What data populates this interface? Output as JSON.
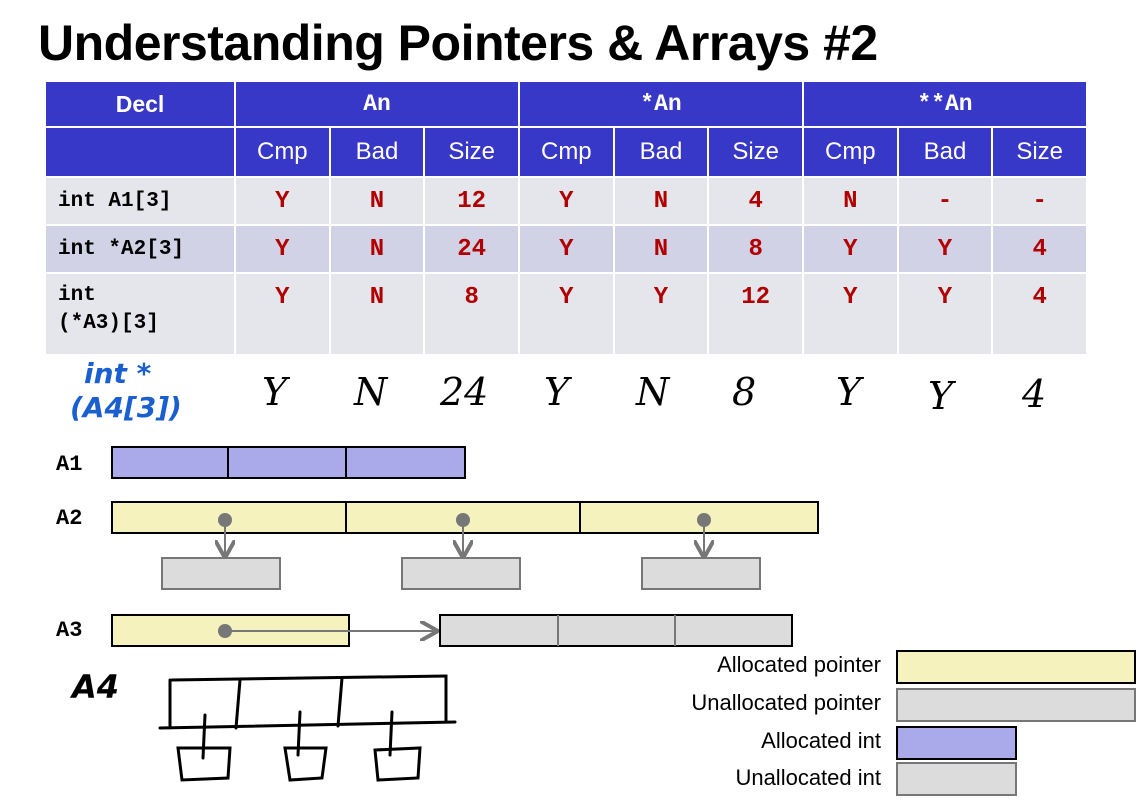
{
  "title": "Understanding Pointers & Arrays #2",
  "table": {
    "header1": [
      "Decl",
      "An",
      "*An",
      "**An"
    ],
    "header2": [
      "Cmp",
      "Bad",
      "Size",
      "Cmp",
      "Bad",
      "Size",
      "Cmp",
      "Bad",
      "Size"
    ],
    "rows": [
      {
        "decl_line1": "int A1[3]",
        "decl_line2": "",
        "cells": [
          "Y",
          "N",
          "12",
          "Y",
          "N",
          "4",
          "N",
          "-",
          "-"
        ]
      },
      {
        "decl_line1": "int *A2[3]",
        "decl_line2": "",
        "cells": [
          "Y",
          "N",
          "24",
          "Y",
          "N",
          "8",
          "Y",
          "Y",
          "4"
        ]
      },
      {
        "decl_line1": "int",
        "decl_line2": "(*A3)[3]",
        "cells": [
          "Y",
          "N",
          "8",
          "Y",
          "Y",
          "12",
          "Y",
          "Y",
          "4"
        ]
      }
    ]
  },
  "handwritten": {
    "decl_line1": "int *",
    "decl_line2": "(A4[3])",
    "cells": [
      "Y",
      "N",
      "24",
      "Y",
      "N",
      "8",
      "Y",
      "Y",
      "4"
    ],
    "a4_label": "A4"
  },
  "diagram": {
    "labels": [
      "A1",
      "A2",
      "A3"
    ]
  },
  "legend": [
    {
      "label": "Allocated  pointer",
      "color": "#f5f2bd"
    },
    {
      "label": "Unallocated pointer",
      "color": "#dcdcdc"
    },
    {
      "label": "Allocated  int",
      "color": "#aaaaea"
    },
    {
      "label": "Unallocated  int",
      "color": "#dcdcdc"
    }
  ]
}
